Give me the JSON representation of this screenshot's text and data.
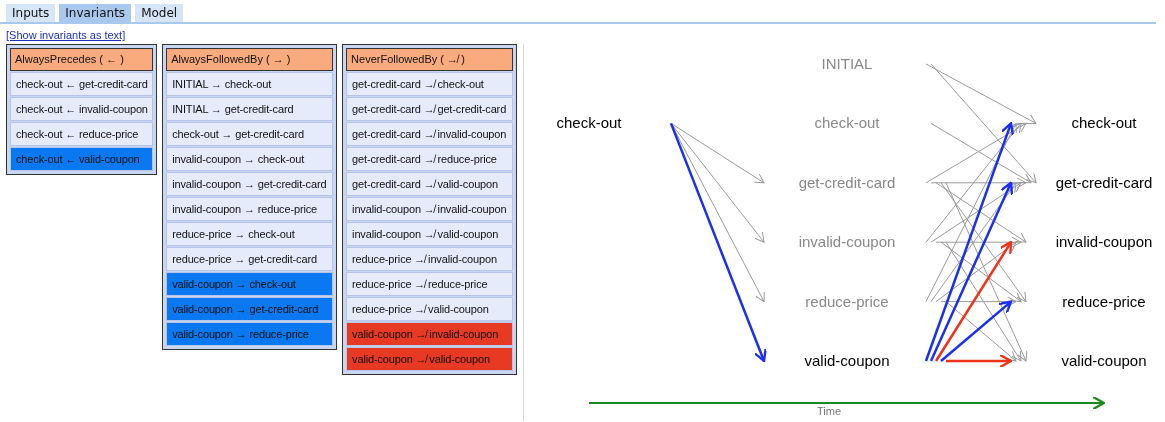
{
  "tabs": [
    {
      "label": "Inputs",
      "selected": false
    },
    {
      "label": "Invariants",
      "selected": true
    },
    {
      "label": "Model",
      "selected": false
    }
  ],
  "show_text_link": "[Show invariants as text]",
  "invariant_tables": [
    {
      "title": "AlwaysPrecedes ( ← )",
      "rows": [
        {
          "text": "check-out ← get-credit-card",
          "kind": "plain"
        },
        {
          "text": "check-out ← invalid-coupon",
          "kind": "plain"
        },
        {
          "text": "check-out ← reduce-price",
          "kind": "plain"
        },
        {
          "text": "check-out ← valid-coupon",
          "kind": "match"
        }
      ]
    },
    {
      "title": "AlwaysFollowedBy ( → )",
      "rows": [
        {
          "text": "INITIAL → check-out",
          "kind": "plain"
        },
        {
          "text": "INITIAL → get-credit-card",
          "kind": "plain"
        },
        {
          "text": "check-out → get-credit-card",
          "kind": "plain"
        },
        {
          "text": "invalid-coupon → check-out",
          "kind": "plain"
        },
        {
          "text": "invalid-coupon → get-credit-card",
          "kind": "plain"
        },
        {
          "text": "invalid-coupon → reduce-price",
          "kind": "plain"
        },
        {
          "text": "reduce-price → check-out",
          "kind": "plain"
        },
        {
          "text": "reduce-price → get-credit-card",
          "kind": "plain"
        },
        {
          "text": "valid-coupon → check-out",
          "kind": "match"
        },
        {
          "text": "valid-coupon → get-credit-card",
          "kind": "match"
        },
        {
          "text": "valid-coupon → reduce-price",
          "kind": "match"
        }
      ]
    },
    {
      "title": "NeverFollowedBy ( ↛ )",
      "rows": [
        {
          "text": "get-credit-card ↛ check-out",
          "kind": "plain"
        },
        {
          "text": "get-credit-card ↛ get-credit-card",
          "kind": "plain"
        },
        {
          "text": "get-credit-card ↛ invalid-coupon",
          "kind": "plain"
        },
        {
          "text": "get-credit-card ↛ reduce-price",
          "kind": "plain"
        },
        {
          "text": "get-credit-card ↛ valid-coupon",
          "kind": "plain"
        },
        {
          "text": "invalid-coupon ↛ invalid-coupon",
          "kind": "plain"
        },
        {
          "text": "invalid-coupon ↛ valid-coupon",
          "kind": "plain"
        },
        {
          "text": "reduce-price ↛ invalid-coupon",
          "kind": "plain"
        },
        {
          "text": "reduce-price ↛ reduce-price",
          "kind": "plain"
        },
        {
          "text": "reduce-price ↛ valid-coupon",
          "kind": "plain"
        },
        {
          "text": "valid-coupon ↛ invalid-coupon",
          "kind": "violation"
        },
        {
          "text": "valid-coupon ↛ valid-coupon",
          "kind": "violation"
        }
      ]
    }
  ],
  "graph": {
    "columns": [
      {
        "nodes": [
          {
            "label": "check-out",
            "active": true,
            "edges": [
              {
                "kind": "none"
              },
              {
                "kind": "none"
              },
              {
                "kind": "plain"
              },
              {
                "kind": "plain"
              },
              {
                "kind": "plain"
              },
              {
                "kind": "match"
              }
            ]
          }
        ]
      },
      {
        "nodes": [
          {
            "label": "INITIAL",
            "active": false,
            "edges": [
              {
                "kind": "plain"
              },
              {
                "kind": "plain"
              },
              {
                "kind": "none"
              },
              {
                "kind": "none"
              },
              {
                "kind": "none"
              }
            ]
          },
          {
            "label": "check-out",
            "active": false,
            "edges": [
              {
                "kind": "none"
              },
              {
                "kind": "plain"
              },
              {
                "kind": "none"
              },
              {
                "kind": "none"
              },
              {
                "kind": "none"
              }
            ]
          },
          {
            "label": "get-credit-card",
            "active": false,
            "edges": [
              {
                "kind": "plain"
              },
              {
                "kind": "plain"
              },
              {
                "kind": "plain"
              },
              {
                "kind": "plain"
              },
              {
                "kind": "plain"
              }
            ]
          },
          {
            "label": "invalid-coupon",
            "active": false,
            "edges": [
              {
                "kind": "plain"
              },
              {
                "kind": "plain"
              },
              {
                "kind": "plain"
              },
              {
                "kind": "plain"
              },
              {
                "kind": "plain"
              }
            ]
          },
          {
            "label": "reduce-price",
            "active": false,
            "edges": [
              {
                "kind": "plain"
              },
              {
                "kind": "plain"
              },
              {
                "kind": "plain"
              },
              {
                "kind": "plain"
              },
              {
                "kind": "plain"
              }
            ]
          },
          {
            "label": "valid-coupon",
            "active": true,
            "edges": [
              {
                "kind": "match"
              },
              {
                "kind": "match"
              },
              {
                "kind": "violation"
              },
              {
                "kind": "match"
              },
              {
                "kind": "violation"
              }
            ]
          }
        ]
      },
      {
        "nodes": [
          {
            "label": "check-out",
            "active": true
          },
          {
            "label": "get-credit-card",
            "active": true
          },
          {
            "label": "invalid-coupon",
            "active": true
          },
          {
            "label": "reduce-price",
            "active": true
          },
          {
            "label": "valid-coupon",
            "active": true
          }
        ]
      }
    ],
    "time_axis_label": "Time"
  }
}
